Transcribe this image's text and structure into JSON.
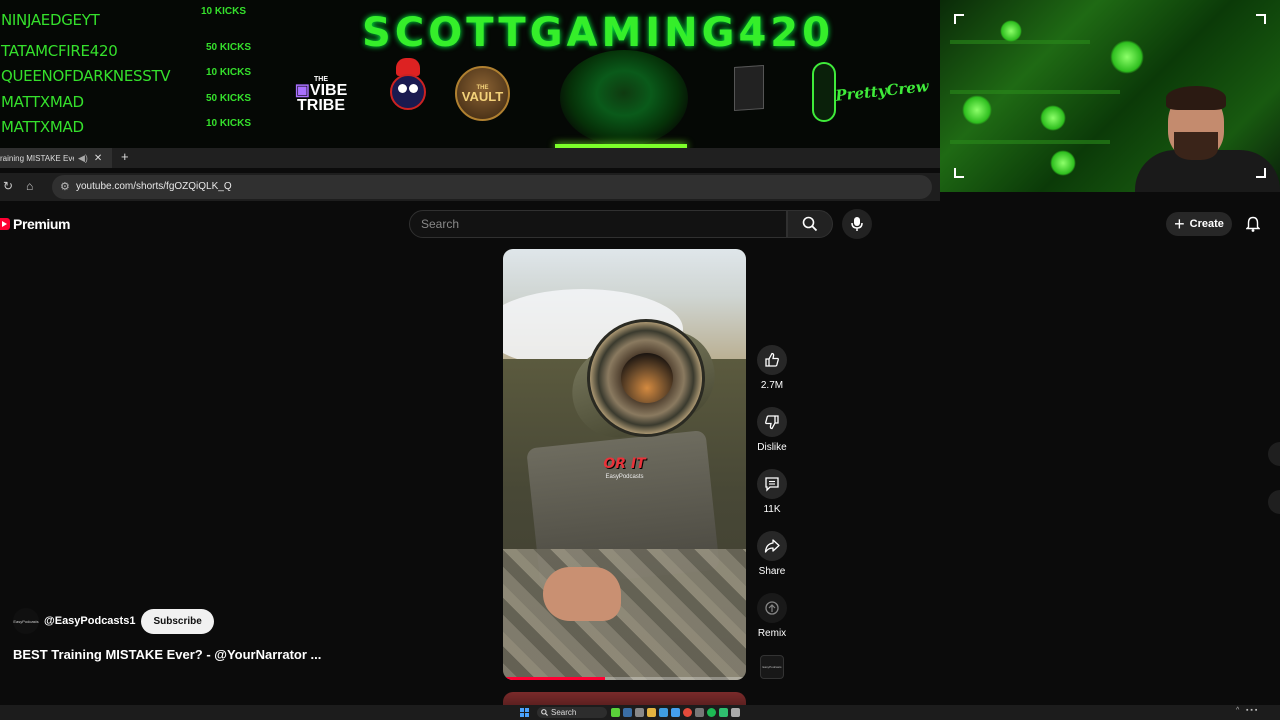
{
  "overlay": {
    "kicks": [
      {
        "name": "NINJAEDGEYT",
        "amount": "10 KICKS"
      },
      {
        "name": "TATAMCFIRE420",
        "amount": "50 KICKS"
      },
      {
        "name": "QUEENOFDARKNESSTV",
        "amount": "10 KICKS"
      },
      {
        "name": "MATTXMAD",
        "amount": "50 KICKS"
      },
      {
        "name": "MATTXMAD",
        "amount": "10 KICKS"
      }
    ],
    "title": "SCOTTGAMING420",
    "vibe_top": "THE",
    "vibe_line1": "VIBE",
    "vibe_line2": "TRIBE",
    "vault_top": "THE",
    "vault_name": "VAULT",
    "pretty_line1": "Pretty",
    "pretty_line2": "Crew"
  },
  "browser": {
    "tab_title": "raining MISTAKE Eve",
    "url": "youtube.com/shorts/fgOZQiQLK_Q"
  },
  "youtube": {
    "brand": "Premium",
    "search_placeholder": "Search",
    "create_label": "Create"
  },
  "short": {
    "caption": "OR IT",
    "watermark": "EasyPodcasts",
    "progress": 0.42,
    "actions": {
      "like_count": "2.7M",
      "dislike_label": "Dislike",
      "comments_count": "11K",
      "share_label": "Share",
      "remix_label": "Remix"
    },
    "channel": "@EasyPodcasts1",
    "subscribe_label": "Subscribe",
    "title": "BEST Training MISTAKE Ever? - @YourNarrator ...",
    "avatar_text": "EasyPodcasts"
  },
  "taskbar": {
    "search_label": "Search"
  },
  "colors": {
    "accent_red": "#ff0033",
    "overlay_green": "#35e02c"
  }
}
